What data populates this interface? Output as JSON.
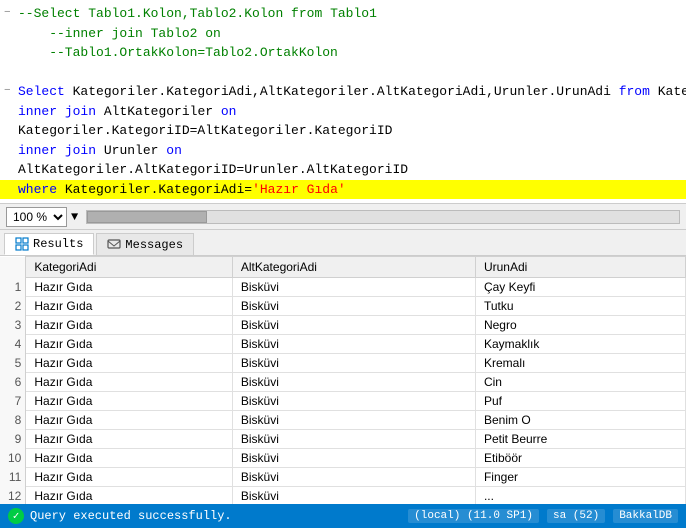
{
  "editor": {
    "lines": [
      {
        "id": 1,
        "has_collapse": true,
        "collapse_symbol": "−",
        "text": "--Select Tablo1.Kolon,Tablo2.Kolon ",
        "text2": "from",
        "text3": " Tablo1",
        "type": "comment"
      },
      {
        "id": 2,
        "has_collapse": false,
        "collapse_symbol": "",
        "text": "    --inner join Tablo2 on",
        "type": "comment"
      },
      {
        "id": 3,
        "has_collapse": false,
        "collapse_symbol": "",
        "text": "    --Tablo1.OrtakKolon=Tablo2.OrtakKolon",
        "type": "comment"
      },
      {
        "id": 4,
        "has_collapse": false,
        "collapse_symbol": "",
        "text": "",
        "type": "blank"
      },
      {
        "id": 5,
        "has_collapse": true,
        "collapse_symbol": "−",
        "keyword": "Select",
        "text": " Kategoriler.KategoriAdi,AltKategoriler.AltKategoriAdi,Urunler.UrunAdi ",
        "text2": "from",
        "text3": " Kategoriler",
        "type": "select"
      },
      {
        "id": 6,
        "has_collapse": false,
        "collapse_symbol": "",
        "kw1": "inner",
        "text1": " ",
        "kw2": "join",
        "text2": " AltKategoriler ",
        "kw3": "on",
        "type": "innerjoin"
      },
      {
        "id": 7,
        "has_collapse": false,
        "text": "Kategoriler.KategoriID=AltKategoriler.KategoriID",
        "type": "normal"
      },
      {
        "id": 8,
        "has_collapse": false,
        "kw1": "inner",
        "text1": " ",
        "kw2": "join",
        "text2": " Urunler ",
        "kw3": "on",
        "type": "innerjoin"
      },
      {
        "id": 9,
        "has_collapse": false,
        "text": "AltKategoriler.AltKategoriID=Urunler.AltKategoriID",
        "type": "normal"
      },
      {
        "id": 10,
        "has_collapse": false,
        "highlight": true,
        "kw": "where",
        "text": " Kategoriler.KategoriAdi=",
        "string": "'Hazır Gıda'",
        "type": "where"
      }
    ]
  },
  "zoom": {
    "value": "100 %"
  },
  "tabs": [
    {
      "id": "results",
      "label": "Results",
      "active": true,
      "icon": "grid-icon"
    },
    {
      "id": "messages",
      "label": "Messages",
      "active": false,
      "icon": "message-icon"
    }
  ],
  "table": {
    "columns": [
      "KategoriAdi",
      "AltKategoriAdi",
      "UrunAdi"
    ],
    "rows": [
      {
        "num": "1",
        "cols": [
          "Hazır Gıda",
          "Bisküvi",
          "Çay Keyfi"
        ]
      },
      {
        "num": "2",
        "cols": [
          "Hazır Gıda",
          "Bisküvi",
          "Tutku"
        ]
      },
      {
        "num": "3",
        "cols": [
          "Hazır Gıda",
          "Bisküvi",
          "Negro"
        ]
      },
      {
        "num": "4",
        "cols": [
          "Hazır Gıda",
          "Bisküvi",
          "Kaymaklık"
        ]
      },
      {
        "num": "5",
        "cols": [
          "Hazır Gıda",
          "Bisküvi",
          "Kremalı"
        ]
      },
      {
        "num": "6",
        "cols": [
          "Hazır Gıda",
          "Bisküvi",
          "Cin"
        ]
      },
      {
        "num": "7",
        "cols": [
          "Hazır Gıda",
          "Bisküvi",
          "Puf"
        ]
      },
      {
        "num": "8",
        "cols": [
          "Hazır Gıda",
          "Bisküvi",
          "Benim O"
        ]
      },
      {
        "num": "9",
        "cols": [
          "Hazır Gıda",
          "Bisküvi",
          "Petit Beurre"
        ]
      },
      {
        "num": "10",
        "cols": [
          "Hazır Gıda",
          "Bisküvi",
          "Etiböör"
        ]
      },
      {
        "num": "11",
        "cols": [
          "Hazır Gıda",
          "Bisküvi",
          "Finger"
        ]
      },
      {
        "num": "12",
        "cols": [
          "Hazır Gıda",
          "Bisküvi",
          "..."
        ]
      }
    ]
  },
  "status": {
    "message": "Query executed successfully.",
    "server": "(local) (11.0 SP1)",
    "user": "sa (52)",
    "db": "BakkalDB"
  }
}
